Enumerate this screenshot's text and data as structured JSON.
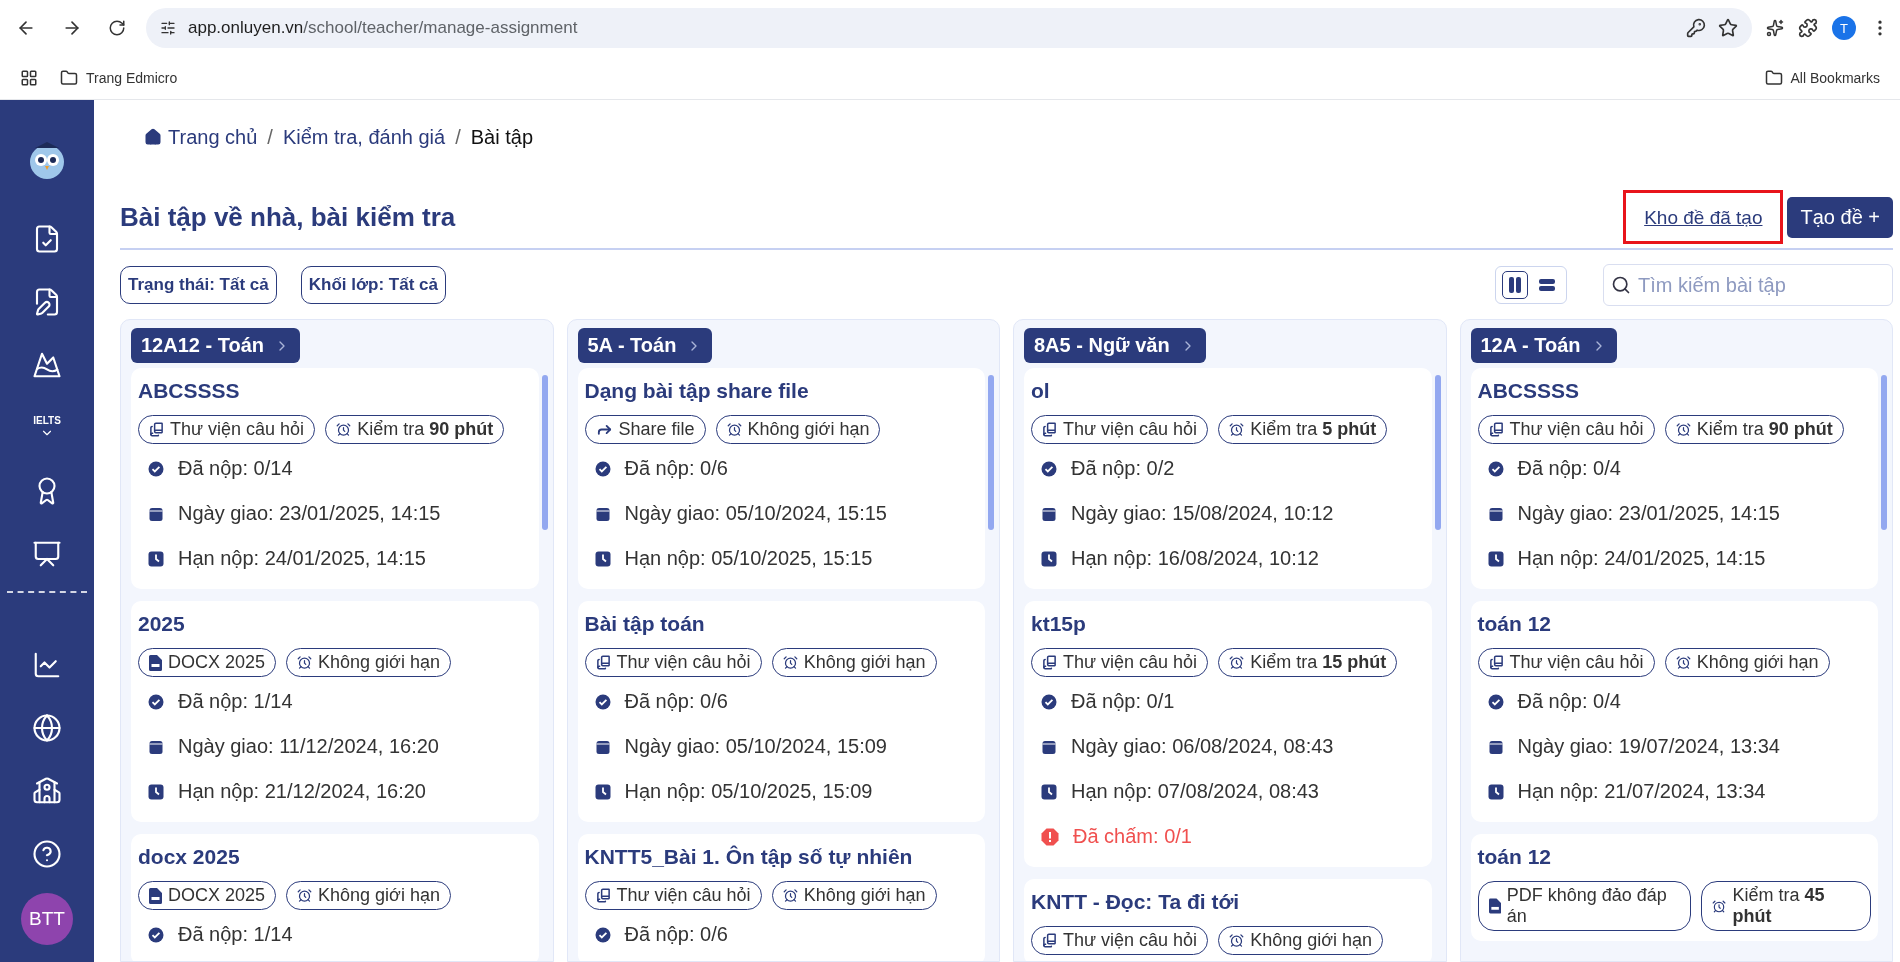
{
  "browser": {
    "url_host": "app.onluyen.vn",
    "url_path": "/school/teacher/manage-assignment",
    "profile": "T",
    "bookmarks": [
      "Trang Edmicro"
    ],
    "all_bookmarks": "All Bookmarks"
  },
  "sidebar": {
    "items": [
      {
        "kind": "assignments"
      },
      {
        "kind": "editor"
      },
      {
        "kind": "goals"
      },
      {
        "kind": "ielts",
        "text": "IELTS"
      },
      {
        "kind": "certificate"
      },
      {
        "kind": "teacher"
      },
      {
        "kind": "divider"
      },
      {
        "kind": "stats"
      },
      {
        "kind": "globe"
      },
      {
        "kind": "school"
      },
      {
        "kind": "help"
      }
    ],
    "avatar": "BTT"
  },
  "breadcrumb": [
    {
      "text": "Trang chủ",
      "kind": "home"
    },
    {
      "text": "/",
      "kind": "separator"
    },
    {
      "text": "Kiểm tra, đánh giá",
      "kind": "link"
    },
    {
      "text": "/",
      "kind": "separator"
    },
    {
      "text": "Bài tập",
      "kind": "current"
    }
  ],
  "page_title": "Bài tập về nhà, bài kiểm tra",
  "actions": {
    "library_link": {
      "text": "Kho đề đã tạo",
      "highlighted": true
    },
    "create_button": "Tạo đề +"
  },
  "filters": [
    "Trạng thái: Tất cả",
    "Khối lớp: Tất cả"
  ],
  "view_toggle": [
    {
      "kind": "columns",
      "selected": true
    },
    {
      "kind": "list",
      "selected": false
    }
  ],
  "search": {
    "placeholder": "Tìm kiếm bài tập"
  },
  "columns": [
    {
      "class_label": "12A12 - Toán",
      "assignments": [
        {
          "title": "ABCSSSS",
          "tags": [
            {
              "kind": "library",
              "text": "Thư viện câu hỏi"
            },
            {
              "kind": "timer",
              "text": "Kiểm tra **90 phút**"
            }
          ],
          "stats": [
            {
              "kind": "submitted",
              "text": "Đã nộp: 0/14"
            },
            {
              "kind": "assigned",
              "text": "Ngày giao: 23/01/2025, 14:15"
            },
            {
              "kind": "deadline",
              "text": "Hạn nộp: 24/01/2025, 14:15"
            }
          ]
        },
        {
          "title": "2025",
          "tags": [
            {
              "kind": "docx",
              "text": "DOCX 2025"
            },
            {
              "kind": "timer",
              "text": "Không giới hạn"
            }
          ],
          "stats": [
            {
              "kind": "submitted",
              "text": "Đã nộp: 1/14"
            },
            {
              "kind": "assigned",
              "text": "Ngày giao: 11/12/2024, 16:20"
            },
            {
              "kind": "deadline",
              "text": "Hạn nộp: 21/12/2024, 16:20"
            }
          ]
        },
        {
          "title": "docx 2025",
          "tags": [
            {
              "kind": "docx",
              "text": "DOCX 2025"
            },
            {
              "kind": "timer",
              "text": "Không giới hạn"
            }
          ],
          "stats": [
            {
              "kind": "submitted",
              "text": "Đã nộp: 1/14"
            }
          ]
        }
      ]
    },
    {
      "class_label": "5A - Toán",
      "assignments": [
        {
          "title": "Dạng bài tập share file",
          "tags": [
            {
              "kind": "share",
              "text": "Share file"
            },
            {
              "kind": "timer",
              "text": "Không giới hạn"
            }
          ],
          "stats": [
            {
              "kind": "submitted",
              "text": "Đã nộp: 0/6"
            },
            {
              "kind": "assigned",
              "text": "Ngày giao: 05/10/2024, 15:15"
            },
            {
              "kind": "deadline",
              "text": "Hạn nộp: 05/10/2025, 15:15"
            }
          ]
        },
        {
          "title": "Bài tập toán",
          "tags": [
            {
              "kind": "library",
              "text": "Thư viện câu hỏi"
            },
            {
              "kind": "timer",
              "text": "Không giới hạn"
            }
          ],
          "stats": [
            {
              "kind": "submitted",
              "text": "Đã nộp: 0/6"
            },
            {
              "kind": "assigned",
              "text": "Ngày giao: 05/10/2024, 15:09"
            },
            {
              "kind": "deadline",
              "text": "Hạn nộp: 05/10/2025, 15:09"
            }
          ]
        },
        {
          "title": "KNTT5_Bài 1. Ôn tập số tự nhiên",
          "tags": [
            {
              "kind": "library",
              "text": "Thư viện câu hỏi"
            },
            {
              "kind": "timer",
              "text": "Không giới hạn"
            }
          ],
          "stats": [
            {
              "kind": "submitted",
              "text": "Đã nộp: 0/6"
            }
          ]
        }
      ]
    },
    {
      "class_label": "8A5 - Ngữ văn",
      "assignments": [
        {
          "title": "ol",
          "tags": [
            {
              "kind": "library",
              "text": "Thư viện câu hỏi"
            },
            {
              "kind": "timer",
              "text": "Kiểm tra **5 phút**"
            }
          ],
          "stats": [
            {
              "kind": "submitted",
              "text": "Đã nộp: 0/2"
            },
            {
              "kind": "assigned",
              "text": "Ngày giao: 15/08/2024, 10:12"
            },
            {
              "kind": "deadline",
              "text": "Hạn nộp: 16/08/2024, 10:12"
            }
          ]
        },
        {
          "title": "kt15p",
          "tags": [
            {
              "kind": "library",
              "text": "Thư viện câu hỏi"
            },
            {
              "kind": "timer",
              "text": "Kiểm tra **15 phút**"
            }
          ],
          "stats": [
            {
              "kind": "submitted",
              "text": "Đã nộp: 0/1"
            },
            {
              "kind": "assigned",
              "text": "Ngày giao: 06/08/2024, 08:43"
            },
            {
              "kind": "deadline",
              "text": "Hạn nộp: 07/08/2024, 08:43"
            },
            {
              "kind": "graded",
              "text": "Đã chấm: 0/1"
            }
          ]
        },
        {
          "title": "KNTT - Đọc: Ta đi tới",
          "tags": [
            {
              "kind": "library",
              "text": "Thư viện câu hỏi"
            },
            {
              "kind": "timer",
              "text": "Không giới hạn"
            }
          ]
        }
      ]
    },
    {
      "class_label": "12A - Toán",
      "assignments": [
        {
          "title": "ABCSSSS",
          "tags": [
            {
              "kind": "library",
              "text": "Thư viện câu hỏi"
            },
            {
              "kind": "timer",
              "text": "Kiểm tra **90 phút**"
            }
          ],
          "stats": [
            {
              "kind": "submitted",
              "text": "Đã nộp: 0/4"
            },
            {
              "kind": "assigned",
              "text": "Ngày giao: 23/01/2025, 14:15"
            },
            {
              "kind": "deadline",
              "text": "Hạn nộp: 24/01/2025, 14:15"
            }
          ]
        },
        {
          "title": "toán 12",
          "tags": [
            {
              "kind": "library",
              "text": "Thư viện câu hỏi"
            },
            {
              "kind": "timer",
              "text": "Không giới hạn"
            }
          ],
          "stats": [
            {
              "kind": "submitted",
              "text": "Đã nộp: 0/4"
            },
            {
              "kind": "assigned",
              "text": "Ngày giao: 19/07/2024, 13:34"
            },
            {
              "kind": "deadline",
              "text": "Hạn nộp: 21/07/2024, 13:34"
            }
          ]
        },
        {
          "title": "toán 12",
          "tags": [
            {
              "kind": "pdf",
              "text": "PDF không đảo đáp án"
            },
            {
              "kind": "timer",
              "text": "Kiểm tra **45 phút**"
            }
          ]
        }
      ]
    }
  ]
}
